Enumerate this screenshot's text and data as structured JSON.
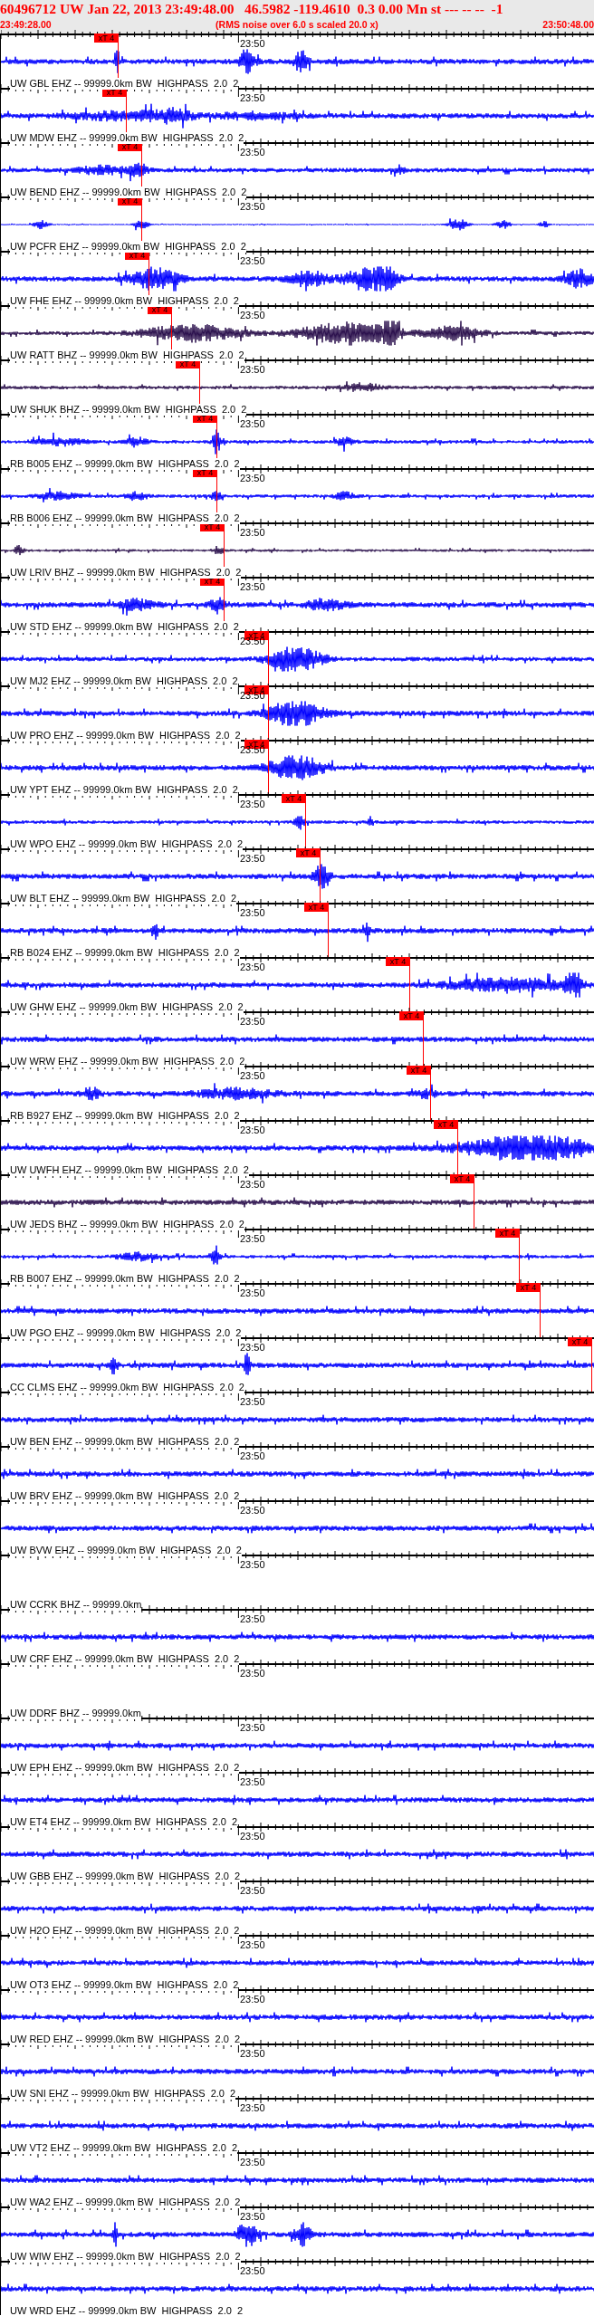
{
  "header": {
    "title": "60496712 UW Jan 22, 2013 23:49:48.00   46.5982 -119.4610  0.3 0.00 Mn st --- -- --  -1",
    "start_time": "23:49:28.00",
    "note": "(RMS noise over 6.0 s scaled 20.0 x)",
    "end_time": "23:50:48.00"
  },
  "traces": [
    {
      "label": "UW GBL EHZ -- 99999.0km BW  HIGHPASS  2.0  2",
      "time_mark": "23:50",
      "color": "#0000ff",
      "pick": "xT 4"
    },
    {
      "label": "UW MDW EHZ -- 99999.0km BW  HIGHPASS  2.0  2",
      "time_mark": "23:50",
      "color": "#0000ff",
      "pick": "xT 4"
    },
    {
      "label": "UW BEND EHZ -- 99999.0km BW  HIGHPASS  2.0  2",
      "time_mark": "23:50",
      "color": "#0000ff",
      "pick": "xT 4"
    },
    {
      "label": "UW PCFR EHZ -- 99999.0km BW  HIGHPASS  2.0  2",
      "time_mark": "23:50",
      "color": "#0000ff",
      "pick": "xT 4"
    },
    {
      "label": "UW FHE EHZ -- 99999.0km BW  HIGHPASS  2.0  2",
      "time_mark": "23:50",
      "color": "#0000ff",
      "pick": "xT 4"
    },
    {
      "label": "UW RATT BHZ -- 99999.0km BW  HIGHPASS  2.0  2",
      "time_mark": "23:50",
      "color": "#2a0f4c",
      "pick": "xT 4"
    },
    {
      "label": "UW SHUK BHZ -- 99999.0km BW  HIGHPASS  2.0  2",
      "time_mark": "23:50",
      "color": "#2a0f4c",
      "pick": "xT 4"
    },
    {
      "label": "RB B005 EHZ -- 99999.0km BW  HIGHPASS  2.0  2",
      "time_mark": "23:50",
      "color": "#0000ff",
      "pick": "xT 4"
    },
    {
      "label": "RB B006 EHZ -- 99999.0km BW  HIGHPASS  2.0  2",
      "time_mark": "23:50",
      "color": "#0000ff",
      "pick": "xT 4"
    },
    {
      "label": "UW LRIV BHZ -- 99999.0km BW  HIGHPASS  2.0  2",
      "time_mark": "23:50",
      "color": "#2a0f4c",
      "pick": "xT 4"
    },
    {
      "label": "UW STD EHZ -- 99999.0km BW  HIGHPASS  2.0  2",
      "time_mark": "23:50",
      "color": "#0000ff",
      "pick": "xT 4"
    },
    {
      "label": "UW MJ2 EHZ -- 99999.0km BW  HIGHPASS  2.0  2",
      "time_mark": "23:50",
      "color": "#0000ff",
      "pick": "xT 4"
    },
    {
      "label": "UW PRO EHZ -- 99999.0km BW  HIGHPASS  2.0  2",
      "time_mark": "23:50",
      "color": "#0000ff",
      "pick": "xT 4"
    },
    {
      "label": "UW YPT EHZ -- 99999.0km BW  HIGHPASS  2.0  2",
      "time_mark": "23:50",
      "color": "#0000ff",
      "pick": "xT 4"
    },
    {
      "label": "UW WPO EHZ -- 99999.0km BW  HIGHPASS  2.0  2",
      "time_mark": "23:50",
      "color": "#0000ff",
      "pick": "xT 4"
    },
    {
      "label": "UW BLT EHZ -- 99999.0km BW  HIGHPASS  2.0  2",
      "time_mark": "23:50",
      "color": "#0000ff",
      "pick": "xT 4"
    },
    {
      "label": "RB B024 EHZ -- 99999.0km BW  HIGHPASS  2.0  2",
      "time_mark": "23:50",
      "color": "#0000ff",
      "pick": "xT 4"
    },
    {
      "label": "UW GHW EHZ -- 99999.0km BW  HIGHPASS  2.0  2",
      "time_mark": "23:50",
      "color": "#0000ff",
      "pick": "xT 4"
    },
    {
      "label": "UW WRW EHZ -- 99999.0km BW  HIGHPASS  2.0  2",
      "time_mark": "23:50",
      "color": "#0000ff",
      "pick": "xT 4"
    },
    {
      "label": "RB B927 EHZ -- 99999.0km BW  HIGHPASS  2.0  2",
      "time_mark": "23:50",
      "color": "#0000ff",
      "pick": "xT 4"
    },
    {
      "label": "UW UWFH EHZ -- 99999.0km BW  HIGHPASS  2.0  2",
      "time_mark": "23:50",
      "color": "#0000ff",
      "pick": "xT 4"
    },
    {
      "label": "UW JEDS BHZ -- 99999.0km BW  HIGHPASS  2.0  2",
      "time_mark": "23:50",
      "color": "#2a0f4c",
      "pick": "xT 4"
    },
    {
      "label": "RB B007 EHZ -- 99999.0km BW  HIGHPASS  2.0  2",
      "time_mark": "23:50",
      "color": "#0000ff",
      "pick": "xT 4"
    },
    {
      "label": "UW PGO EHZ -- 99999.0km BW  HIGHPASS  2.0  2",
      "time_mark": "23:50",
      "color": "#0000ff",
      "pick": "xT 4"
    },
    {
      "label": "CC CLMS EHZ -- 99999.0km BW  HIGHPASS  2.0  2",
      "time_mark": "23:50",
      "color": "#0000ff",
      "pick": "xT 4"
    },
    {
      "label": "UW BEN EHZ -- 99999.0km BW  HIGHPASS  2.0  2",
      "time_mark": "23:50",
      "color": "#0000ff"
    },
    {
      "label": "UW BRV EHZ -- 99999.0km BW  HIGHPASS  2.0  2",
      "time_mark": "23:50",
      "color": "#0000ff"
    },
    {
      "label": "UW BVW EHZ -- 99999.0km BW  HIGHPASS  2.0  2",
      "time_mark": "23:50",
      "color": "#0000ff"
    },
    {
      "label": "UW CCRK BHZ -- 99999.0km",
      "time_mark": "23:50"
    },
    {
      "label": "UW CRF EHZ -- 99999.0km BW  HIGHPASS  2.0  2",
      "time_mark": "23:50",
      "color": "#0000ff"
    },
    {
      "label": "UW DDRF BHZ -- 99999.0km",
      "time_mark": "23:50"
    },
    {
      "label": "UW EPH EHZ -- 99999.0km BW  HIGHPASS  2.0  2",
      "time_mark": "23:50",
      "color": "#0000ff"
    },
    {
      "label": "UW ET4 EHZ -- 99999.0km BW  HIGHPASS  2.0  2",
      "time_mark": "23:50",
      "color": "#0000ff"
    },
    {
      "label": "UW GBB EHZ -- 99999.0km BW  HIGHPASS  2.0  2",
      "time_mark": "23:50",
      "color": "#0000ff"
    },
    {
      "label": "UW H2O EHZ -- 99999.0km BW  HIGHPASS  2.0  2",
      "time_mark": "23:50",
      "color": "#0000ff"
    },
    {
      "label": "UW OT3 EHZ -- 99999.0km BW  HIGHPASS  2.0  2",
      "time_mark": "23:50",
      "color": "#0000ff"
    },
    {
      "label": "UW RED EHZ -- 99999.0km BW  HIGHPASS  2.0  2",
      "time_mark": "23:50",
      "color": "#0000ff"
    },
    {
      "label": "UW SNI EHZ -- 99999.0km BW  HIGHPASS  2.0  2",
      "time_mark": "23:50",
      "color": "#0000ff"
    },
    {
      "label": "UW VT2 EHZ -- 99999.0km BW  HIGHPASS  2.0  2",
      "time_mark": "23:50",
      "color": "#0000ff"
    },
    {
      "label": "UW WA2 EHZ -- 99999.0km BW  HIGHPASS  2.0  2",
      "time_mark": "23:50",
      "color": "#0000ff"
    },
    {
      "label": "UW WIW EHZ -- 99999.0km BW  HIGHPASS  2.0  2",
      "time_mark": "23:50",
      "color": "#0000ff"
    },
    {
      "label": "UW WRD EHZ -- 99999.0km BW  HIGHPASS  2.0  2",
      "time_mark": "23:50",
      "color": "#0000ff"
    }
  ]
}
